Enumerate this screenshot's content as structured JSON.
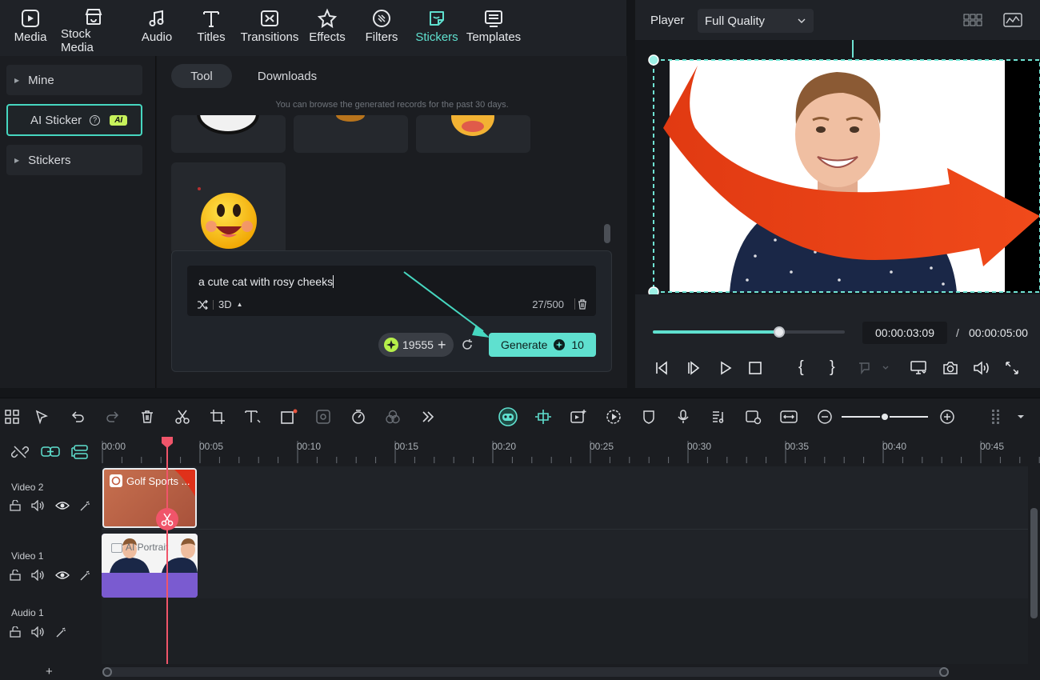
{
  "toolbar": {
    "tabs": [
      {
        "label": "Media",
        "icon": "media-icon"
      },
      {
        "label": "Stock Media",
        "icon": "stock-media-icon"
      },
      {
        "label": "Audio",
        "icon": "audio-icon"
      },
      {
        "label": "Titles",
        "icon": "titles-icon"
      },
      {
        "label": "Transitions",
        "icon": "transitions-icon"
      },
      {
        "label": "Effects",
        "icon": "effects-icon"
      },
      {
        "label": "Filters",
        "icon": "filters-icon"
      },
      {
        "label": "Stickers",
        "icon": "stickers-icon",
        "active": true
      },
      {
        "label": "Templates",
        "icon": "templates-icon"
      }
    ]
  },
  "sidebar": {
    "items": [
      {
        "label": "Mine"
      },
      {
        "label": "AI Sticker",
        "badge": "AI",
        "active": true
      },
      {
        "label": "Stickers"
      }
    ]
  },
  "stickers_panel": {
    "tabs": [
      {
        "label": "Tool",
        "active": true
      },
      {
        "label": "Downloads"
      }
    ],
    "hint": "You can browse the generated records for the past 30 days."
  },
  "prompt": {
    "text": "a cute cat with rosy cheeks",
    "style": "3D",
    "counter": "27/500",
    "credits": "19555",
    "generate_label": "Generate",
    "generate_cost": "10"
  },
  "player": {
    "label": "Player",
    "quality": "Full Quality",
    "current_time": "00:00:03:09",
    "separator": "/",
    "total_time": "00:00:05:00",
    "progress": 0.66
  },
  "timeline": {
    "ruler": [
      "00:00",
      "00:05",
      "00:10",
      "00:15",
      "00:20",
      "00:25",
      "00:30",
      "00:35",
      "00:40",
      "00:45"
    ],
    "tracks": [
      {
        "name": "Video 2"
      },
      {
        "name": "Video 1"
      },
      {
        "name": "Audio 1"
      }
    ],
    "clips": {
      "video2": "Golf Sports ...",
      "video1": "AI Portrait"
    }
  },
  "colors": {
    "accent": "#5fe0cf",
    "playhead": "#f0556a",
    "ai_badge": "#c7f25b"
  }
}
